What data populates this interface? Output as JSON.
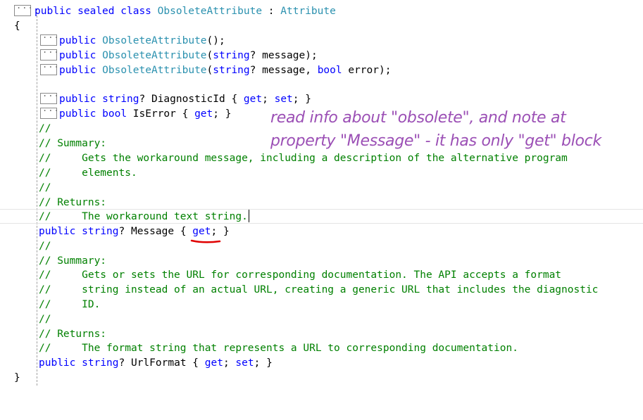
{
  "code": {
    "class_decl": {
      "public": "public",
      "sealed": "sealed",
      "class_kw": "class",
      "name": "ObsoleteAttribute",
      "colon": " : ",
      "base": "Attribute"
    },
    "open_brace": "{",
    "close_brace": "}",
    "ctor1": {
      "public": "public",
      "name": "ObsoleteAttribute",
      "tail": "();"
    },
    "ctor2": {
      "public": "public",
      "name": "ObsoleteAttribute",
      "paren": "(",
      "type": "string",
      "rest": "? message);"
    },
    "ctor3": {
      "public": "public",
      "name": "ObsoleteAttribute",
      "paren": "(",
      "type": "string",
      "rest1": "? message, ",
      "bool": "bool",
      "rest2": " error);"
    },
    "prop_diag": {
      "public": "public",
      "type": "string",
      "mid": "? DiagnosticId { ",
      "get": "get",
      "semi1": "; ",
      "set": "set",
      "tail": "; }"
    },
    "prop_iserror": {
      "public": "public",
      "type": "bool",
      "mid": " IsError { ",
      "get": "get",
      "tail": "; }"
    },
    "c1": "//",
    "c2": "// Summary:",
    "c3": "//     Gets the workaround message, including a description of the alternative program",
    "c4": "//     elements.",
    "c5": "//",
    "c6": "// Returns:",
    "c7": "//     The workaround text string.",
    "prop_message": {
      "public": "public",
      "type": "string",
      "mid": "? Message { ",
      "get": "get",
      "tail": "; }"
    },
    "d1": "//",
    "d2": "// Summary:",
    "d3": "//     Gets or sets the URL for corresponding documentation. The API accepts a format",
    "d4": "//     string instead of an actual URL, creating a generic URL that includes the diagnostic",
    "d5": "//     ID.",
    "d6": "//",
    "d7": "// Returns:",
    "d8": "//     The format string that represents a URL to corresponding documentation.",
    "prop_url": {
      "public": "public",
      "type": "string",
      "mid": "? UrlFormat { ",
      "get": "get",
      "semi1": "; ",
      "set": "set",
      "tail": "; }"
    },
    "fold_label": "..."
  },
  "annotation": {
    "line1": "read info about \"obsolete\", and note at",
    "line2": "property \"Message\" - it has only \"get\" block"
  },
  "colors": {
    "keyword": "#0000ff",
    "type": "#2b91af",
    "comment": "#008000",
    "note": "#9b4fb5",
    "underline": "#e00000"
  }
}
